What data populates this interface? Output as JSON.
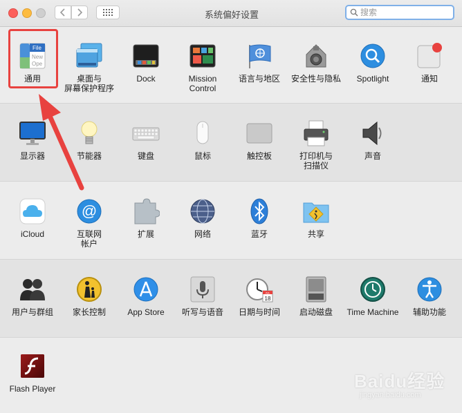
{
  "window": {
    "title": "系统偏好设置",
    "search_placeholder": "搜索"
  },
  "rows": [
    [
      {
        "id": "general",
        "label": "通用",
        "icon": "general-icon"
      },
      {
        "id": "desktop",
        "label": "桌面与\n屏幕保护程序",
        "icon": "desktop-screensaver-icon"
      },
      {
        "id": "dock",
        "label": "Dock",
        "icon": "dock-icon"
      },
      {
        "id": "mission",
        "label": "Mission\nControl",
        "icon": "mission-control-icon"
      },
      {
        "id": "language",
        "label": "语言与地区",
        "icon": "language-region-icon"
      },
      {
        "id": "security",
        "label": "安全性与隐私",
        "icon": "security-privacy-icon"
      },
      {
        "id": "spotlight",
        "label": "Spotlight",
        "icon": "spotlight-icon"
      },
      {
        "id": "notifications",
        "label": "通知",
        "icon": "notifications-icon"
      }
    ],
    [
      {
        "id": "displays",
        "label": "显示器",
        "icon": "displays-icon"
      },
      {
        "id": "energy",
        "label": "节能器",
        "icon": "energy-saver-icon"
      },
      {
        "id": "keyboard",
        "label": "键盘",
        "icon": "keyboard-icon"
      },
      {
        "id": "mouse",
        "label": "鼠标",
        "icon": "mouse-icon"
      },
      {
        "id": "trackpad",
        "label": "触控板",
        "icon": "trackpad-icon"
      },
      {
        "id": "printers",
        "label": "打印机与\n扫描仪",
        "icon": "printer-icon"
      },
      {
        "id": "sound",
        "label": "声音",
        "icon": "sound-icon"
      }
    ],
    [
      {
        "id": "icloud",
        "label": "iCloud",
        "icon": "icloud-icon"
      },
      {
        "id": "internet",
        "label": "互联网\n帐户",
        "icon": "internet-accounts-icon"
      },
      {
        "id": "extensions",
        "label": "扩展",
        "icon": "extensions-icon"
      },
      {
        "id": "network",
        "label": "网络",
        "icon": "network-icon"
      },
      {
        "id": "bluetooth",
        "label": "蓝牙",
        "icon": "bluetooth-icon"
      },
      {
        "id": "sharing",
        "label": "共享",
        "icon": "sharing-icon"
      }
    ],
    [
      {
        "id": "users",
        "label": "用户与群组",
        "icon": "users-groups-icon"
      },
      {
        "id": "parental",
        "label": "家长控制",
        "icon": "parental-controls-icon"
      },
      {
        "id": "appstore",
        "label": "App Store",
        "icon": "app-store-icon"
      },
      {
        "id": "dictation",
        "label": "听写与语音",
        "icon": "dictation-speech-icon"
      },
      {
        "id": "datetime",
        "label": "日期与时间",
        "icon": "date-time-icon"
      },
      {
        "id": "startup",
        "label": "启动磁盘",
        "icon": "startup-disk-icon"
      },
      {
        "id": "timemachine",
        "label": "Time Machine",
        "icon": "time-machine-icon"
      },
      {
        "id": "accessibility",
        "label": "辅助功能",
        "icon": "accessibility-icon"
      }
    ],
    [
      {
        "id": "flash",
        "label": "Flash Player",
        "icon": "flash-player-icon"
      }
    ]
  ],
  "icon_text": {
    "general_file": "File",
    "general_new": "New",
    "general_open": "Ope",
    "calendar_month": "JUL",
    "calendar_day": "18"
  },
  "watermark": {
    "main": "Baidu经验",
    "sub": "jingyan.baidu.com"
  },
  "colors": {
    "highlight": "#e8423f",
    "search_focus": "#7fb0e8"
  }
}
